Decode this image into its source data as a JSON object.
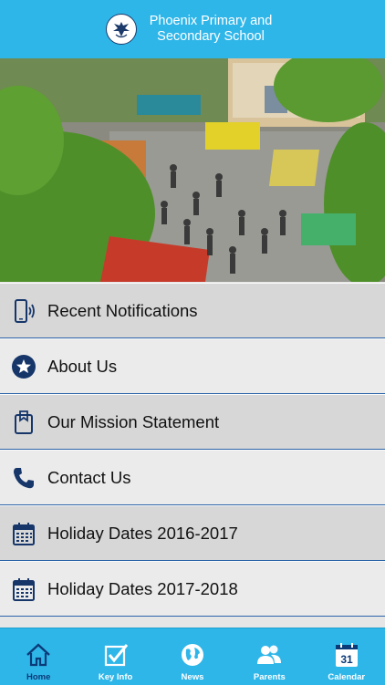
{
  "header": {
    "school_name_line1": "Phoenix Primary and",
    "school_name_line2": "Secondary School",
    "logo_icon": "phoenix-crest-icon"
  },
  "hero": {
    "description": "school-fair-photo"
  },
  "menu": {
    "items": [
      {
        "label": "Recent Notifications",
        "icon": "phone-notification-icon"
      },
      {
        "label": "About Us",
        "icon": "star-icon"
      },
      {
        "label": "Our Mission Statement",
        "icon": "clipboard-icon"
      },
      {
        "label": "Contact Us",
        "icon": "telephone-icon"
      },
      {
        "label": "Holiday Dates 2016-2017",
        "icon": "calendar-icon"
      },
      {
        "label": "Holiday Dates 2017-2018",
        "icon": "calendar-icon"
      }
    ]
  },
  "tabbar": {
    "tabs": [
      {
        "label": "Home",
        "icon": "home-icon",
        "active": true
      },
      {
        "label": "Key Info",
        "icon": "checkbox-icon",
        "active": false
      },
      {
        "label": "News",
        "icon": "globe-icon",
        "active": false
      },
      {
        "label": "Parents",
        "icon": "people-icon",
        "active": false
      },
      {
        "label": "Calendar",
        "icon": "calendar-date-icon",
        "active": false,
        "date": "31"
      }
    ]
  },
  "colors": {
    "brand_blue": "#2fb6e9",
    "navy": "#1c3b6b",
    "divider": "#2b63a8",
    "active_tab": "#0b3a78"
  }
}
